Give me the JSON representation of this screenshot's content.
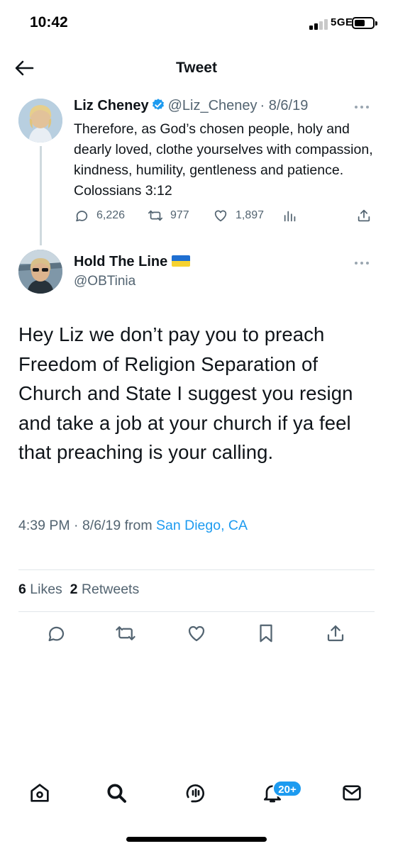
{
  "status_bar": {
    "time": "10:42",
    "network": "5GE"
  },
  "header": {
    "title": "Tweet"
  },
  "parent_tweet": {
    "name": "Liz Cheney",
    "handle": "@Liz_Cheney",
    "date": "· 8/6/19",
    "text": "Therefore, as God’s chosen people, holy and dearly loved, clothe yourselves with compassion, kindness, humility, gentleness and patience. Colossians 3:12",
    "replies": "6,226",
    "retweets": "977",
    "likes": "1,897"
  },
  "reply_tweet": {
    "name": "Hold The Line",
    "handle": "@OBTinia",
    "text": "Hey Liz we don’t pay you to preach Freedom of Religion Separation of Church and State I suggest you resign and take a job at your church if ya feel that preaching is your calling.",
    "time": "4:39 PM · 8/6/19 from",
    "location": "San Diego, CA",
    "likes_count": "6",
    "likes_label": "Likes",
    "retweets_count": "2",
    "retweets_label": "Retweets"
  },
  "bottom_nav": {
    "notifications_badge": "20+"
  },
  "colors": {
    "accent": "#1d9bf0",
    "secondary_text": "#536471",
    "divider": "#e1e6ea"
  },
  "icons": [
    "back-arrow-icon",
    "verified-icon",
    "more-icon",
    "reply-icon",
    "retweet-icon",
    "like-icon",
    "analytics-icon",
    "share-icon",
    "bookmark-icon",
    "home-icon",
    "search-icon",
    "spaces-icon",
    "notifications-icon",
    "messages-icon"
  ]
}
